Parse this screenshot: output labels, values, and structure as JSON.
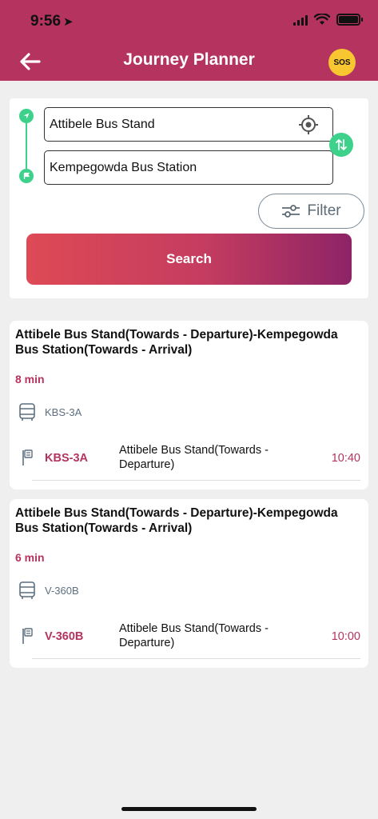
{
  "status_bar": {
    "time": "9:56"
  },
  "header": {
    "title": "Journey Planner",
    "sos_label": "SOS",
    "color": "#b5335f"
  },
  "search": {
    "origin": "Attibele Bus Stand",
    "destination": "Kempegowda Bus Station",
    "filter_label": "Filter",
    "search_label": "Search"
  },
  "results": [
    {
      "title": "Attibele Bus Stand(Towards - Departure)-Kempegowda Bus Station(Towards - Arrival)",
      "duration": "8 min",
      "route_small": "KBS-3A",
      "route": "KBS-3A",
      "stop": "Attibele Bus Stand(Towards - Departure)",
      "time": "10:40"
    },
    {
      "title": "Attibele Bus Stand(Towards - Departure)-Kempegowda Bus Station(Towards - Arrival)",
      "duration": "6 min",
      "route_small": "V-360B",
      "route": "V-360B",
      "stop": "Attibele Bus Stand(Towards - Departure)",
      "time": "10:00"
    }
  ]
}
